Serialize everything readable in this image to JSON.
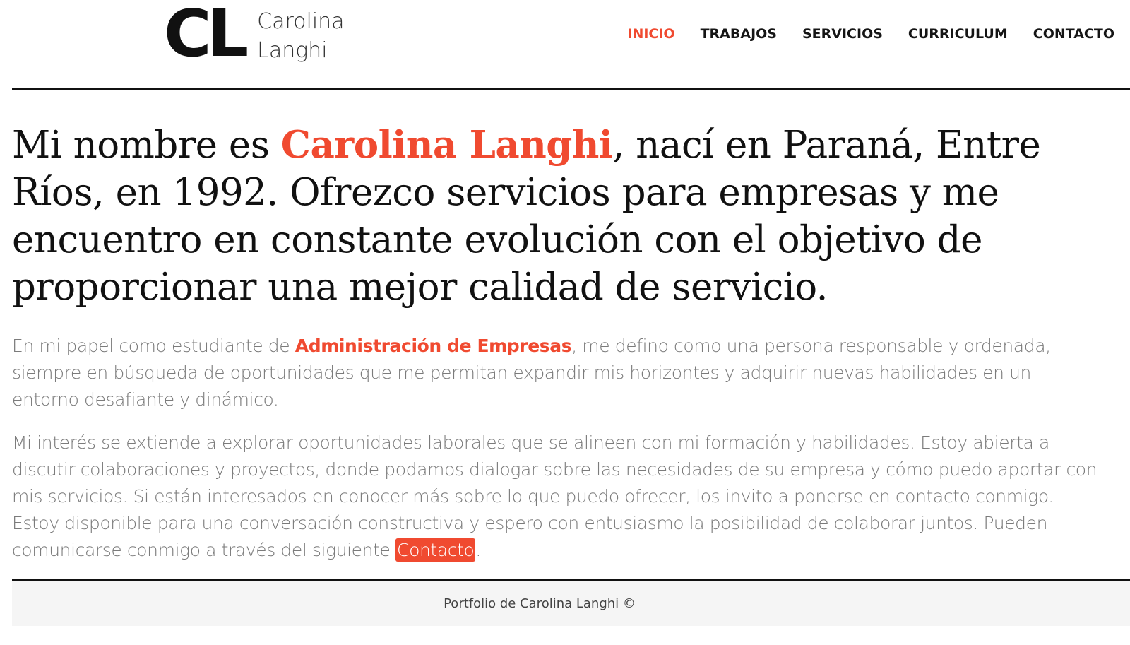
{
  "header": {
    "logo_mark": "CL",
    "logo_first_name": "Carolina",
    "logo_last_name": "Langhi",
    "nav": [
      {
        "label": "INICIO",
        "active": true
      },
      {
        "label": "TRABAJOS",
        "active": false
      },
      {
        "label": "SERVICIOS",
        "active": false
      },
      {
        "label": "CURRICULUM",
        "active": false
      },
      {
        "label": "CONTACTO",
        "active": false
      }
    ]
  },
  "intro": {
    "prefix": "Mi nombre es ",
    "name": "Carolina Langhi",
    "suffix": ", nací en Paraná, Entre Ríos, en 1992. Ofrezco servicios para empresas y me encuentro en constante evolución con el objetivo de proporcionar una mejor calidad de servicio."
  },
  "paragraph1": {
    "prefix": "En mi papel como estudiante de ",
    "highlight": "Administración de Empresas",
    "suffix": ", me defino como una persona responsable y ordenada, siempre en búsqueda de oportunidades que me permitan expandir mis horizontes y adquirir nuevas habilidades en un entorno desafiante y dinámico."
  },
  "paragraph2": {
    "text": "Mi interés se extiende a explorar oportunidades laborales que se alineen con mi formación y habilidades. Estoy abierta a discutir colaboraciones y proyectos, donde podamos dialogar sobre las necesidades de su empresa y cómo puedo aportar con mis servicios. Si están interesados en conocer más sobre lo que puedo ofrecer, los invito a ponerse en contacto conmigo. Estoy disponible para una conversación constructiva y espero con entusiasmo la posibilidad de colaborar juntos. Pueden comunicarse conmigo a través del siguiente ",
    "link_label": "Contacto",
    "end": "."
  },
  "footer": {
    "text": "Portfolio de Carolina Langhi ©"
  },
  "colors": {
    "accent": "#f04a30",
    "body_text": "#7b7b7b",
    "footer_bg": "#f5f5f5"
  }
}
